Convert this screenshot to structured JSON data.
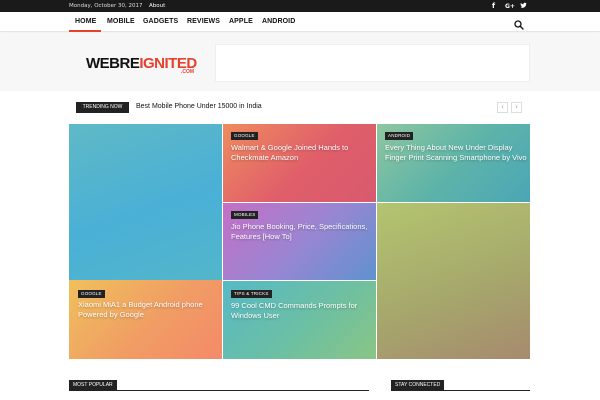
{
  "topbar": {
    "date": "Monday, October 30, 2017",
    "about": "About",
    "social": [
      {
        "icon": "facebook-icon",
        "glyph": "f"
      },
      {
        "icon": "google-plus-icon",
        "glyph": "G+"
      },
      {
        "icon": "twitter-icon",
        "glyph": "t"
      }
    ]
  },
  "nav": {
    "items": [
      "HOME",
      "MOBILE",
      "GADGETS",
      "REVIEWS",
      "APPLE",
      "ANDROID"
    ],
    "active": "HOME",
    "accent": "#e5412d"
  },
  "header": {
    "logo_main": "WEBREIGNITED",
    "logo_sub": ".COM"
  },
  "trending": {
    "label": "TRENDING NOW",
    "text": "Best Mobile Phone Under 15000 in India",
    "prev": "‹",
    "next": "›"
  },
  "grid": [
    {
      "tag": "GOOGLE",
      "title": "Walmart & Google Joined Hands to Checkmate Amazon"
    },
    {
      "tag": "ANDROID",
      "title": "Every Thing About New Under Display Finger Print Scanning Smartphone by Vivo"
    },
    {
      "tag": "MOBILES",
      "title": "Jio Phone Booking, Price, Specifications, Features [How To]"
    },
    {
      "tag": "GOOGLE",
      "title": "Xiaomi MiA1 a Budget Android phone Powered by Google"
    },
    {
      "tag": "TIPS & TRICKS",
      "title": "99 Cool CMD Commands Prompts for Windows User"
    }
  ],
  "sections": {
    "most_popular": "MOST POPULAR",
    "stay_connected": "STAY CONNECTED"
  }
}
